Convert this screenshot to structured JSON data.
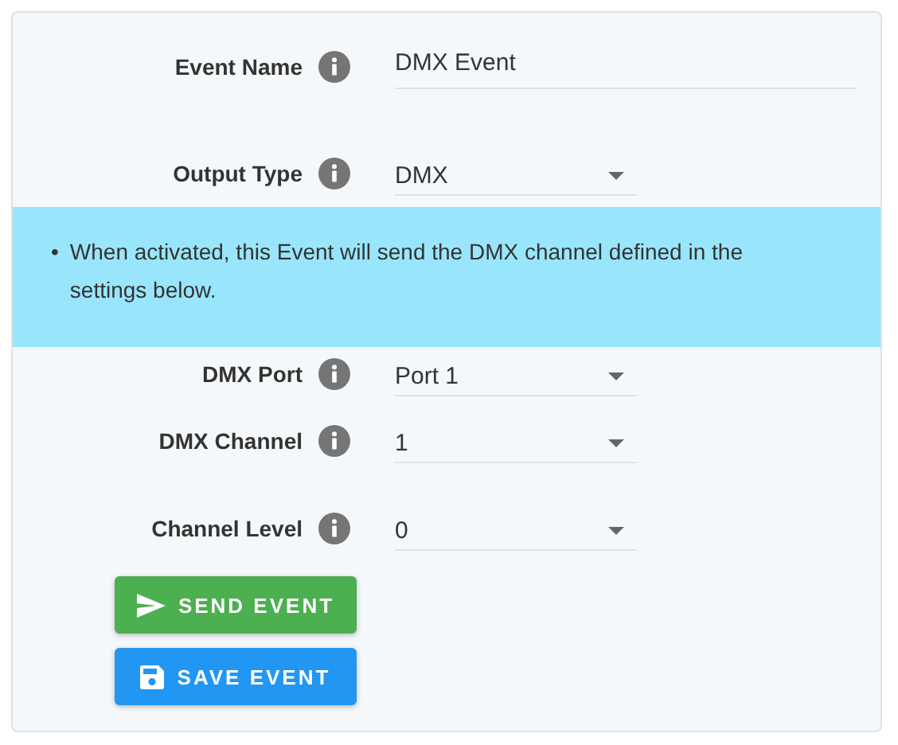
{
  "fields_top": [
    {
      "label": "Event Name",
      "kind": "text",
      "value": "DMX Event"
    },
    {
      "label": "Output Type",
      "kind": "select",
      "value": "DMX"
    }
  ],
  "notice": {
    "items": [
      {
        "marker": "•",
        "text": "When activated, this Event will send the DMX channel defined in the settings below."
      }
    ]
  },
  "fields_bottom": [
    {
      "label": "DMX Port",
      "kind": "select",
      "value": "Port 1"
    },
    {
      "label": "DMX Channel",
      "kind": "select",
      "value": "1"
    },
    {
      "label": "Channel Level",
      "kind": "select",
      "value": "0"
    }
  ],
  "buttons": [
    {
      "label": "SEND EVENT",
      "kind": "send"
    },
    {
      "label": "SAVE EVENT",
      "kind": "save"
    }
  ]
}
